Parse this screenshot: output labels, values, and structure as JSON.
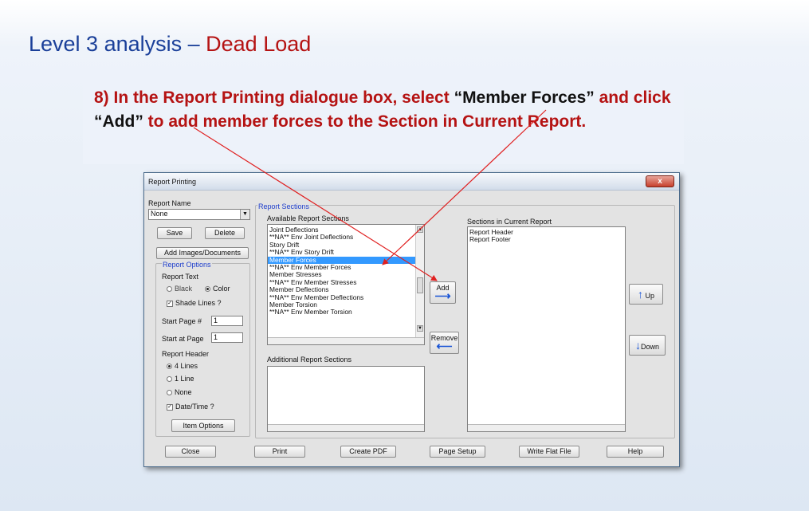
{
  "slide": {
    "title_prefix": "Level 3 analysis",
    "title_dash": " – ",
    "title_emph": "Dead Load",
    "instruction": {
      "part1": "8) In the Report Printing dialogue box, select ",
      "quote1": "“Member Forces”",
      "part2": " and click ",
      "quote2": "“Add”",
      "part3": " to add member forces to the Section in Current Report."
    }
  },
  "dialog": {
    "title": "Report Printing",
    "close_label": "x",
    "report_name": {
      "label": "Report Name",
      "value": "None",
      "save": "Save",
      "delete": "Delete",
      "add_images": "Add Images/Documents"
    },
    "report_options": {
      "legend": "Report Options",
      "report_text": "Report Text",
      "black": "Black",
      "color": "Color",
      "shade_lines": "Shade Lines ?",
      "start_page_label": "Start Page #",
      "start_page_value": "1",
      "start_at_page_label": "Start at Page",
      "start_at_page_value": "1",
      "report_header": "Report Header",
      "lines4": "4 Lines",
      "line1": "1 Line",
      "none": "None",
      "date_time": "Date/Time ?",
      "item_options": "Item Options"
    },
    "report_sections": {
      "legend": "Report Sections",
      "available_label": "Available Report Sections",
      "available_items": [
        "Joint Deflections",
        "**NA** Env Joint Deflections",
        "Story Drift",
        "**NA** Env Story Drift",
        "Member Forces",
        "**NA** Env Member Forces",
        "Member Stresses",
        "**NA** Env Member Stresses",
        "Member Deflections",
        "**NA** Env Member Deflections",
        "Member Torsion",
        "**NA** Env Member Torsion"
      ],
      "selected_item": "Member Forces",
      "additional_label": "Additional Report Sections",
      "add": "Add",
      "remove": "Remove",
      "current_label": "Sections in Current Report",
      "current_items": [
        "Report Header",
        "Report Footer"
      ],
      "up": "Up",
      "down": "Down"
    },
    "bottom_buttons": {
      "close": "Close",
      "print": "Print",
      "create_pdf": "Create PDF",
      "page_setup": "Page Setup",
      "write_flat_file": "Write Flat File",
      "help": "Help"
    },
    "icons": {
      "add": "right-arrow-icon",
      "remove": "left-arrow-icon",
      "up": "up-arrow-icon",
      "down": "down-arrow-icon"
    }
  },
  "colors": {
    "title_blue": "#1a3f99",
    "emphasis_red": "#b51313",
    "selection_blue": "#3399ff",
    "annotation_arrow": "#e02020"
  }
}
